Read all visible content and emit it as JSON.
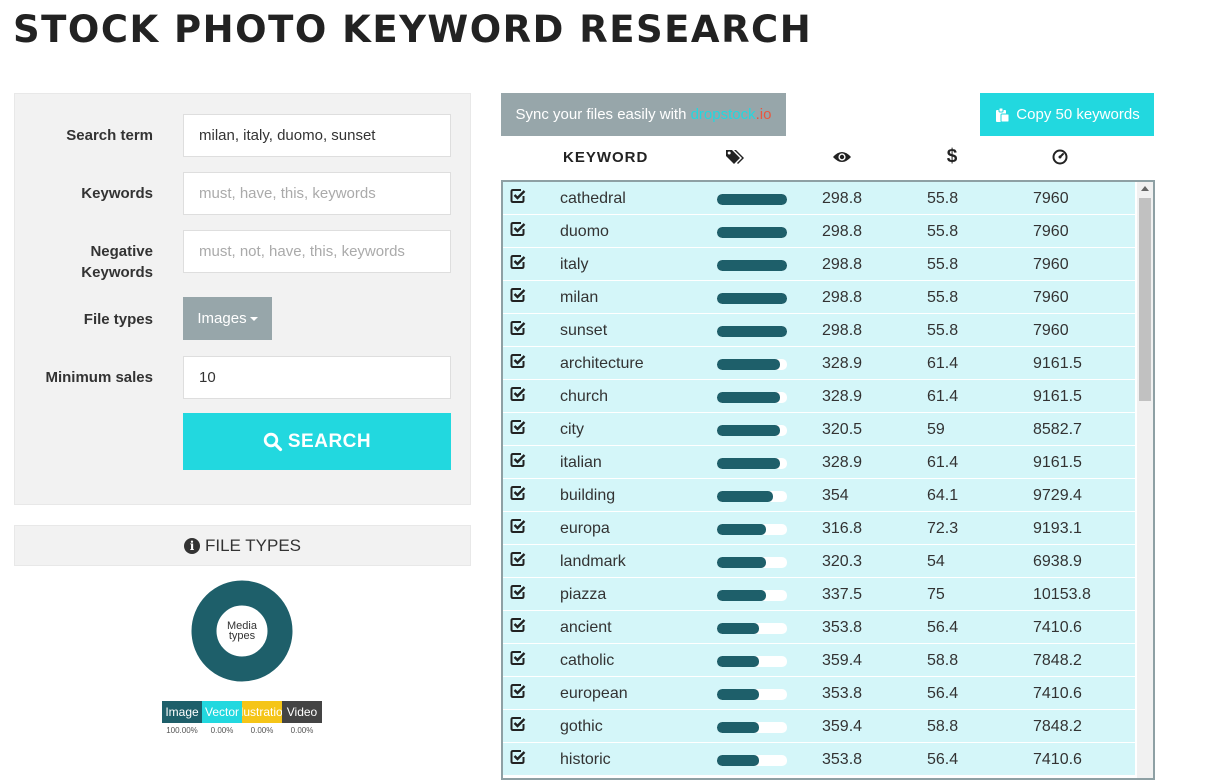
{
  "header": {
    "title": "STOCK PHOTO KEYWORD RESEARCH"
  },
  "search_form": {
    "search_term": {
      "label": "Search term",
      "value": "milan, italy, duomo, sunset"
    },
    "keywords": {
      "label": "Keywords",
      "placeholder": "must, have, this, keywords"
    },
    "negative_keywords": {
      "label_line1": "Negative",
      "label_line2": "Keywords",
      "placeholder": "must, not, have, this, keywords"
    },
    "file_types": {
      "label": "File types",
      "selected": "Images"
    },
    "minimum_sales": {
      "label": "Minimum sales",
      "value": "10"
    },
    "search_button_label": "SEARCH"
  },
  "file_types_panel": {
    "title": "FILE TYPES",
    "donut_label_line1": "Media",
    "donut_label_line2": "types",
    "legend": [
      {
        "label": "Image",
        "percent": "100.00%",
        "color": "#1e5f6a",
        "share": 100
      },
      {
        "label": "Vector",
        "percent": "0.00%",
        "color": "#22d8df",
        "share": 0
      },
      {
        "label": "Illustration",
        "percent": "0.00%",
        "color": "#f5c518",
        "share": 0
      },
      {
        "label": "Video",
        "percent": "0.00%",
        "color": "#444444",
        "share": 0
      }
    ]
  },
  "sync_banner": {
    "text": "Sync your files easily with ",
    "link_main": "dropstock",
    "link_dot": ".io"
  },
  "copy_button_label": "Copy 50 keywords",
  "table": {
    "keyword_header": "KEYWORD",
    "header_icons": [
      "tags-icon",
      "eye-icon",
      "dollar-icon",
      "dashboard-icon"
    ],
    "rows": [
      {
        "keyword": "cathedral",
        "bar": 100,
        "views": "298.8",
        "price": "55.8",
        "sales": "7960"
      },
      {
        "keyword": "duomo",
        "bar": 100,
        "views": "298.8",
        "price": "55.8",
        "sales": "7960"
      },
      {
        "keyword": "italy",
        "bar": 100,
        "views": "298.8",
        "price": "55.8",
        "sales": "7960"
      },
      {
        "keyword": "milan",
        "bar": 100,
        "views": "298.8",
        "price": "55.8",
        "sales": "7960"
      },
      {
        "keyword": "sunset",
        "bar": 100,
        "views": "298.8",
        "price": "55.8",
        "sales": "7960"
      },
      {
        "keyword": "architecture",
        "bar": 90,
        "views": "328.9",
        "price": "61.4",
        "sales": "9161.5"
      },
      {
        "keyword": "church",
        "bar": 90,
        "views": "328.9",
        "price": "61.4",
        "sales": "9161.5"
      },
      {
        "keyword": "city",
        "bar": 90,
        "views": "320.5",
        "price": "59",
        "sales": "8582.7"
      },
      {
        "keyword": "italian",
        "bar": 90,
        "views": "328.9",
        "price": "61.4",
        "sales": "9161.5"
      },
      {
        "keyword": "building",
        "bar": 80,
        "views": "354",
        "price": "64.1",
        "sales": "9729.4"
      },
      {
        "keyword": "europa",
        "bar": 70,
        "views": "316.8",
        "price": "72.3",
        "sales": "9193.1"
      },
      {
        "keyword": "landmark",
        "bar": 70,
        "views": "320.3",
        "price": "54",
        "sales": "6938.9"
      },
      {
        "keyword": "piazza",
        "bar": 70,
        "views": "337.5",
        "price": "75",
        "sales": "10153.8"
      },
      {
        "keyword": "ancient",
        "bar": 60,
        "views": "353.8",
        "price": "56.4",
        "sales": "7410.6"
      },
      {
        "keyword": "catholic",
        "bar": 60,
        "views": "359.4",
        "price": "58.8",
        "sales": "7848.2"
      },
      {
        "keyword": "european",
        "bar": 60,
        "views": "353.8",
        "price": "56.4",
        "sales": "7410.6"
      },
      {
        "keyword": "gothic",
        "bar": 60,
        "views": "359.4",
        "price": "58.8",
        "sales": "7848.2"
      },
      {
        "keyword": "historic",
        "bar": 60,
        "views": "353.8",
        "price": "56.4",
        "sales": "7410.6"
      }
    ]
  }
}
